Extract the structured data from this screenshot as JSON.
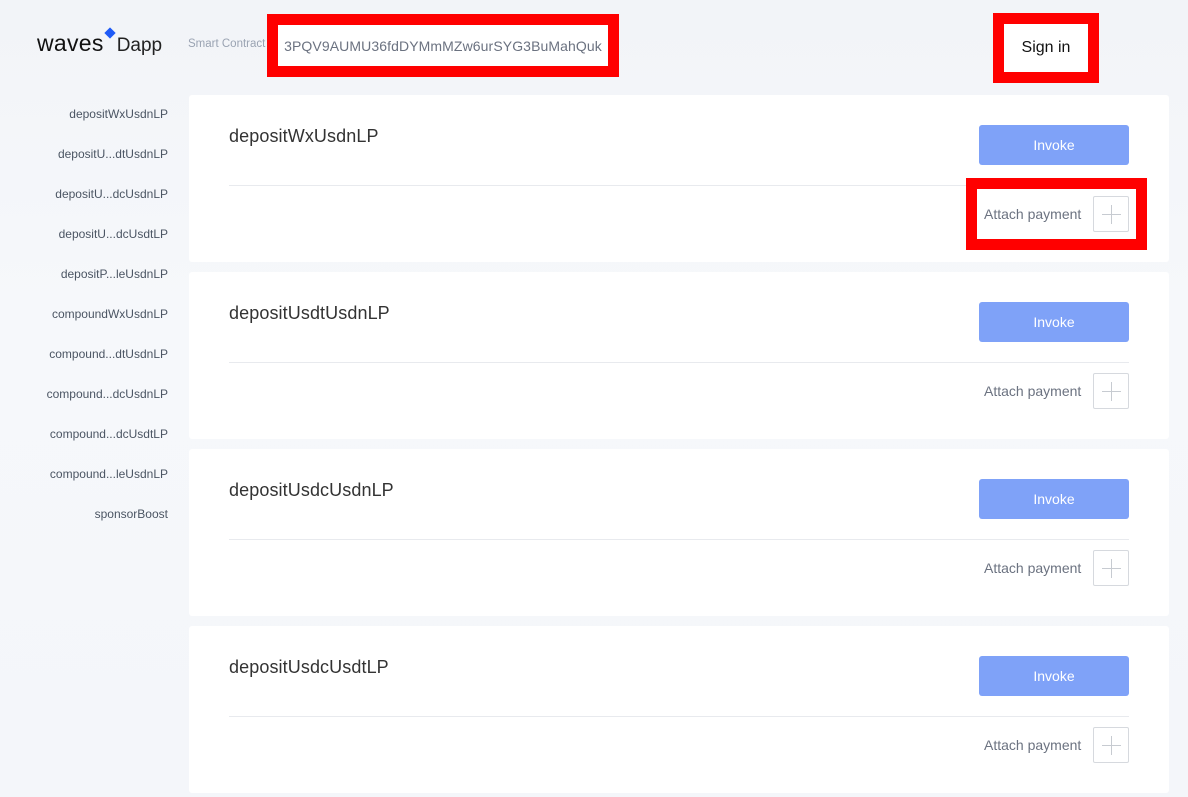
{
  "header": {
    "logo_text": "waves",
    "logo_suffix": "Dapp",
    "contract_label": "Smart Contract",
    "contract_address": "3PQV9AUMU36fdDYMmMZw6urSYG3BuMahQuk",
    "signin_label": "Sign in"
  },
  "sidebar": {
    "items": [
      {
        "label": "depositWxUsdnLP"
      },
      {
        "label": "depositU...dtUsdnLP"
      },
      {
        "label": "depositU...dcUsdnLP"
      },
      {
        "label": "depositU...dcUsdtLP"
      },
      {
        "label": "depositP...leUsdnLP"
      },
      {
        "label": "compoundWxUsdnLP"
      },
      {
        "label": "compound...dtUsdnLP"
      },
      {
        "label": "compound...dcUsdnLP"
      },
      {
        "label": "compound...dcUsdtLP"
      },
      {
        "label": "compound...leUsdnLP"
      },
      {
        "label": "sponsorBoost"
      }
    ]
  },
  "cards": [
    {
      "title": "depositWxUsdnLP",
      "invoke_label": "Invoke",
      "attach_label": "Attach payment"
    },
    {
      "title": "depositUsdtUsdnLP",
      "invoke_label": "Invoke",
      "attach_label": "Attach payment"
    },
    {
      "title": "depositUsdcUsdnLP",
      "invoke_label": "Invoke",
      "attach_label": "Attach payment"
    },
    {
      "title": "depositUsdcUsdtLP",
      "invoke_label": "Invoke",
      "attach_label": "Attach payment"
    }
  ],
  "colors": {
    "accent": "#7fa2f8",
    "brand_diamond": "#1f5af6",
    "highlight": "#ff0000"
  }
}
